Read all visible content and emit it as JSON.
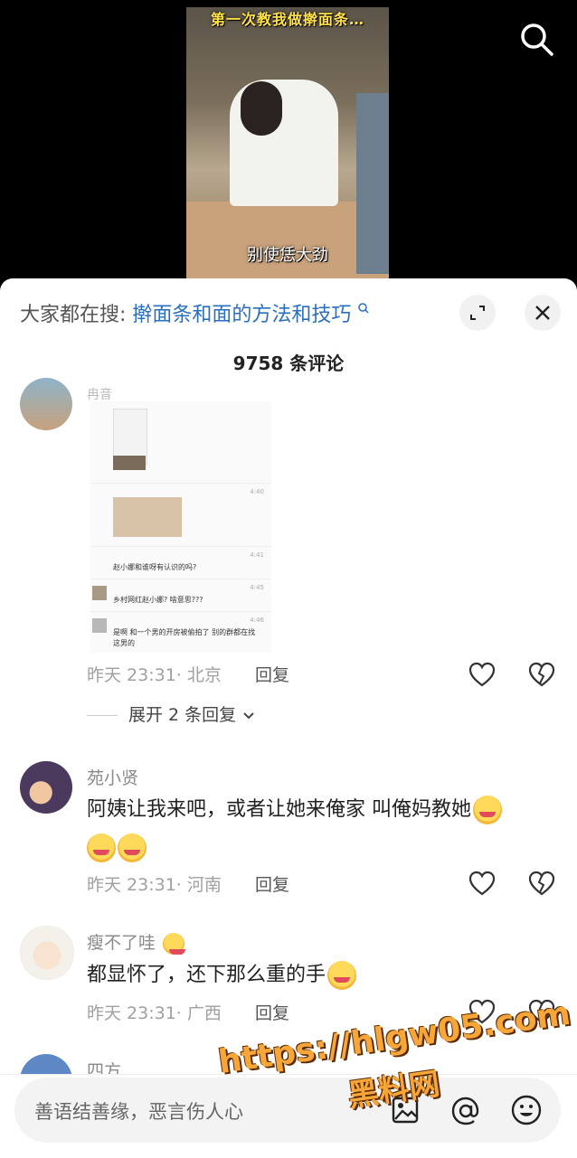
{
  "video": {
    "title_text": "第一次教我做擀面条…",
    "subtitle": "别使恁大劲"
  },
  "panel": {
    "hot_search_prefix": "大家都在搜:",
    "hot_search_query": "擀面条和面的方法和技巧",
    "comment_count": "9758 条评论"
  },
  "comments": [
    {
      "user": "冉音",
      "chat_lines": [
        "赵小娜和谁呀有认识的吗?",
        "乡村网红赵小娜? 啥意思???",
        "是啊 和一个男的开房被偷拍了 别的群都在找",
        "这男的"
      ],
      "chat_times": [
        "4:40",
        "4:41",
        "4:45",
        "4:46"
      ],
      "time": "昨天 23:31· 北京",
      "reply": "回复",
      "expand": "展开 2 条回复"
    },
    {
      "user": "苑小贤",
      "text": "阿姨让我来吧，或者让她来俺家 叫俺妈教她",
      "time": "昨天 23:31· 河南",
      "reply": "回复"
    },
    {
      "user": "瘦不了哇",
      "text": "都显怀了，还下那么重的手",
      "time": "昨天 23:31· 广西",
      "reply": "回复"
    },
    {
      "user": "四方"
    }
  ],
  "input": {
    "placeholder": "善语结善缘，恶言伤人心"
  },
  "watermark": {
    "line1": "https://hlgw05.com",
    "line2": "黑料网"
  },
  "colors": {
    "accent_blue": "#2a6fbf",
    "watermark_orange": "#f7a63a"
  }
}
